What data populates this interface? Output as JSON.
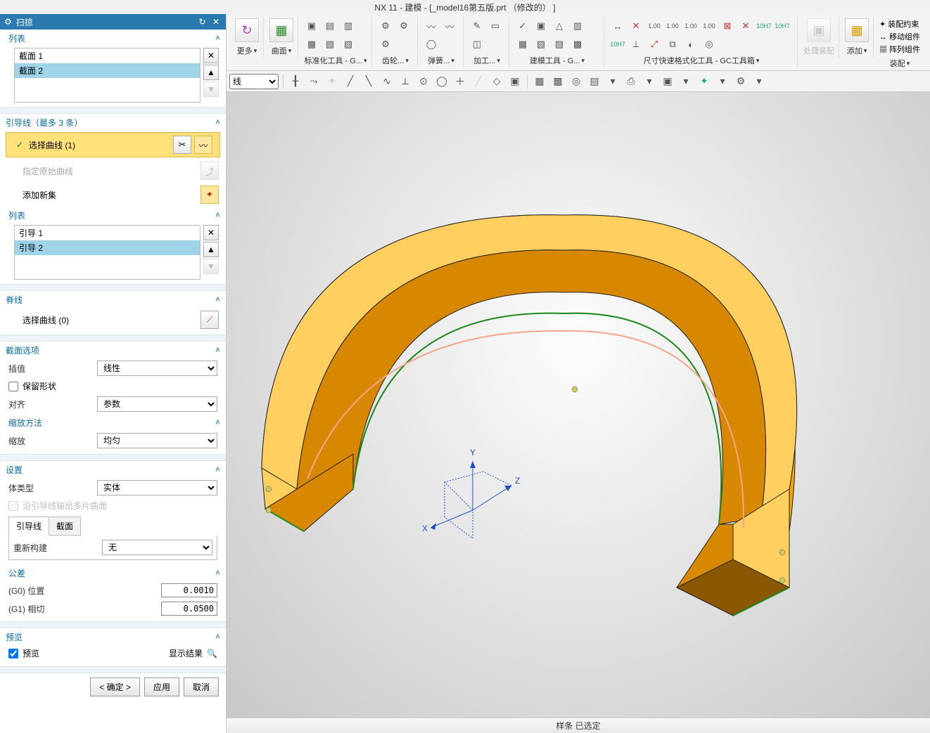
{
  "app": {
    "title": "NX 11 - 建模 - [_model16第五版.prt （修改的）  ]"
  },
  "dialog": {
    "title": "扫掠",
    "section_list": {
      "label": "列表",
      "items": [
        "截面 1",
        "截面 2"
      ],
      "selected": 1
    },
    "guides": {
      "header": "引导线（最多 3 条）",
      "select_curve": "选择曲线 (1)",
      "origin_curve": "指定原始曲线",
      "add_set": "添加新集",
      "list_label": "列表",
      "items": [
        "引导 1",
        "引导 2"
      ],
      "selected": 1
    },
    "spine": {
      "header": "脊线",
      "select": "选择曲线 (0)"
    },
    "section_options": {
      "header": "截面选项",
      "interp_label": "插值",
      "interp_value": "线性",
      "keep_shape_label": "保留形状",
      "align_label": "对齐",
      "align_value": "参数",
      "scale_method_header": "缩放方法",
      "scale_label": "缩放",
      "scale_value": "均匀"
    },
    "settings": {
      "header": "设置",
      "body_type_label": "体类型",
      "body_type_value": "实体",
      "multi_patch_label": "沿引导线输出多片曲面",
      "tab_guide": "引导线",
      "tab_section": "截面",
      "rebuild_label": "重新构建",
      "rebuild_value": "无",
      "tolerance_header": "公差",
      "g0_label": "(G0) 位置",
      "g0_value": "0.0010",
      "g1_label": "(G1) 相切",
      "g1_value": "0.0500"
    },
    "preview": {
      "header": "预览",
      "checkbox": "预览",
      "show_result": "显示结果"
    },
    "buttons": {
      "ok": "< 确定 >",
      "apply": "应用",
      "cancel": "取消"
    }
  },
  "ribbon": {
    "more": "更多",
    "surface": "曲面",
    "group_std": "标准化工具 - G...",
    "group_gear": "齿轮...",
    "group_spring": "弹簧...",
    "group_mach": "加工...",
    "group_model": "建模工具 - G...",
    "group_dim": "尺寸快速格式化工具 - GC工具箱",
    "assembly_proc": "处理装配",
    "assembly_add": "添加",
    "assembly_label": "装配",
    "assy_cons": "装配约束",
    "move_comp": "移动组件",
    "array_comp": "阵列组件"
  },
  "selection_toolbar": {
    "filter": "线"
  },
  "status": "样条 已选定",
  "axes": {
    "x": "X",
    "y": "Y",
    "z": "Z"
  }
}
